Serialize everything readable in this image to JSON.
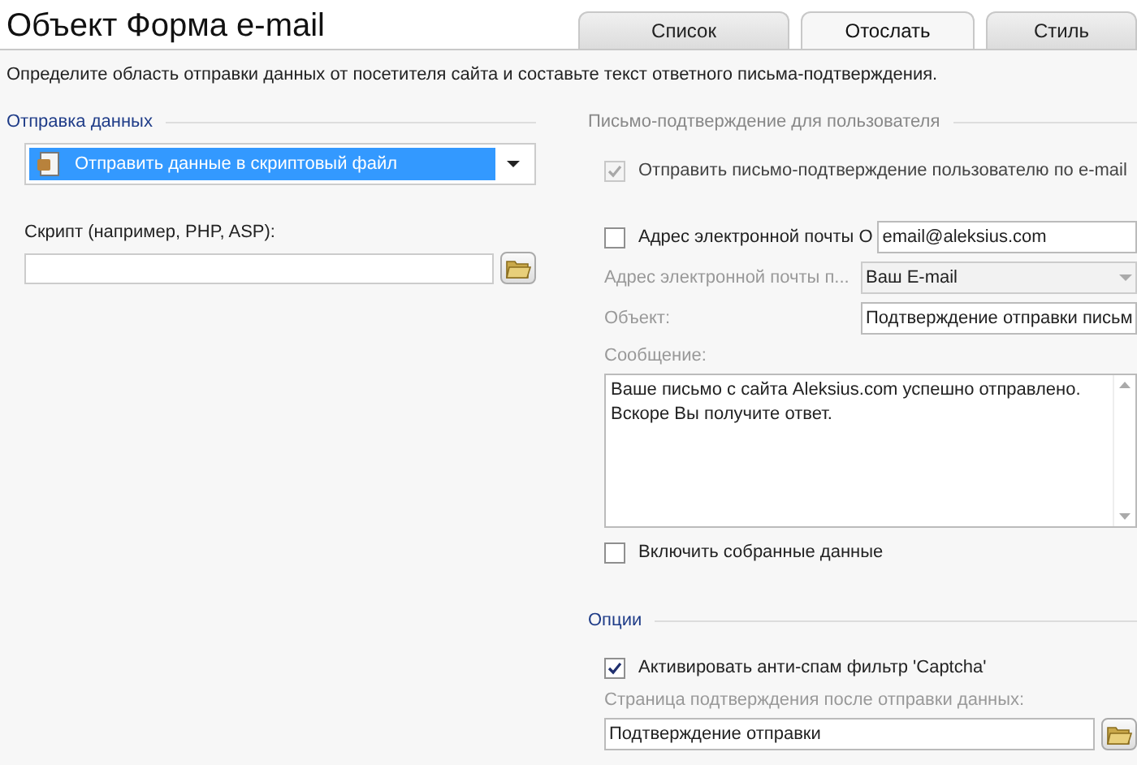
{
  "window": {
    "title": "Объект Форма e-mail"
  },
  "tabs": [
    {
      "label": "Список",
      "selected": false
    },
    {
      "label": "Отослать",
      "selected": true
    },
    {
      "label": "Стиль",
      "selected": false
    }
  ],
  "description": "Определите область отправки данных от посетителя сайта и составьте текст ответного письма-подтверждения.",
  "data_sending": {
    "legend": "Отправка данных",
    "method": {
      "value": "Отправить данные в скриптовый файл",
      "selected": true
    },
    "script_label": "Скрипт (например, PHP, ASP):"
  },
  "confirmation": {
    "legend": "Письмо-подтверждение для пользователя",
    "send_checkbox": {
      "label": "Отправить письмо-подтверждение пользователю по e-mail",
      "checked": true,
      "disabled": true
    },
    "from_checkbox": {
      "label": "Адрес электронной почты О",
      "checked": false,
      "disabled": false
    },
    "from_value": "email@aleksius.com",
    "to_label": "Адрес электронной почты п...",
    "to_value": "Ваш E-mail",
    "subject_label": "Объект:",
    "subject_value": "Подтверждение отправки письм",
    "message_label": "Сообщение:",
    "message_value": "Ваше письмо с сайта Aleksius.com успешно отправлено.\nВскоре Вы получите ответ.",
    "include_checkbox": {
      "label": "Включить собранные данные",
      "checked": false,
      "disabled": false
    }
  },
  "options": {
    "legend": "Опции",
    "captcha_checkbox": {
      "label": "Активировать анти-спам фильтр 'Captcha'",
      "checked": true,
      "disabled": false
    },
    "page_label": "Страница подтверждения после отправки данных:",
    "page_value": "Подтверждение отправки"
  }
}
